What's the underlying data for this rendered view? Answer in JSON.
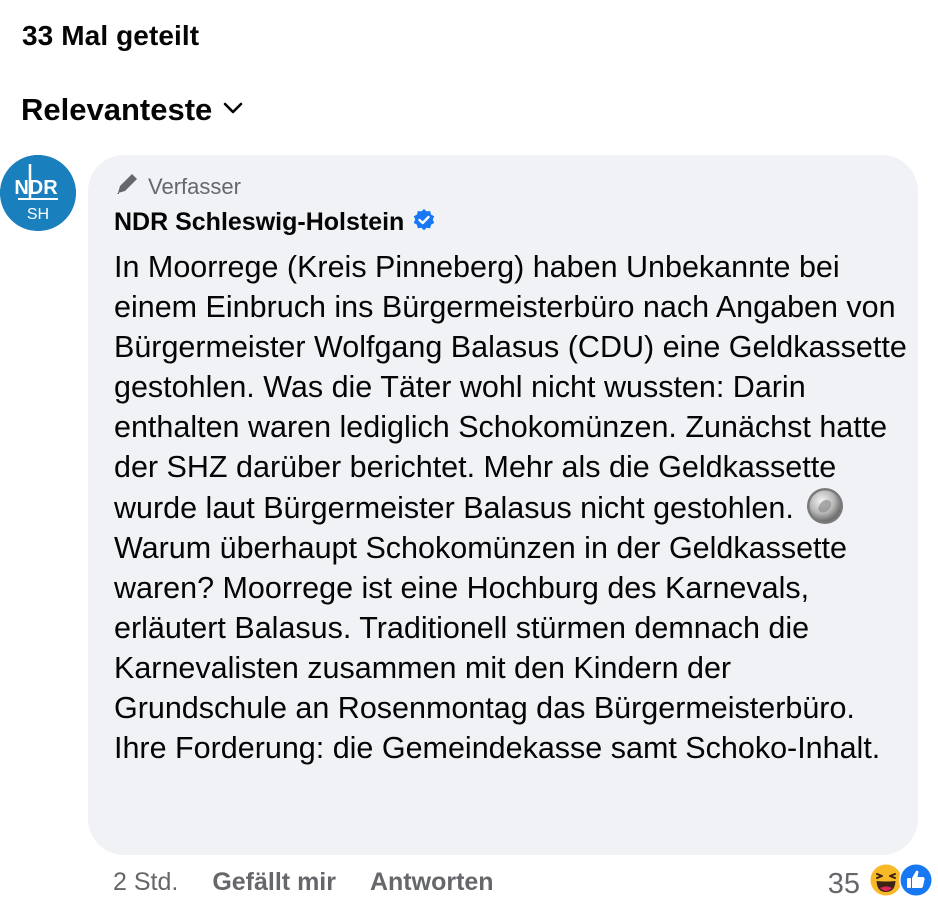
{
  "header": {
    "share_count": "33 Mal geteilt",
    "sort_label": "Relevanteste"
  },
  "comment": {
    "avatar": {
      "line1": "NDR",
      "line2": "SH",
      "bg_color": "#1a7fbd"
    },
    "badge_label": "Verfasser",
    "author": "NDR Schleswig-Holstein",
    "verified_color": "#1877f2",
    "text_part1": "In Moorrege (Kreis Pinneberg) haben Unbekannte bei einem Einbruch ins Bürgermeisterbüro nach Angaben von Bürgermeister Wolfgang Balasus (CDU) eine Geldkassette gestohlen. Was die Täter wohl nicht wussten: Darin enthalten waren lediglich Schokomünzen. Zunächst hatte der SHZ darüber berichtet. Mehr als die Geldkassette wurde laut Bürgermeister Balasus nicht gestohlen.",
    "text_part2": "Warum überhaupt Schokomünzen in der Geldkassette waren? Moorrege ist eine Hochburg des Karnevals, erläutert Balasus. Traditionell stürmen demnach die Karnevalisten zusammen mit den Kindern der Grundschule an Rosenmontag das Bürgermeisterbüro. Ihre Forderung: die Gemeindekasse samt Schoko-Inhalt.",
    "emoji_icon": "coin-emoji",
    "time": "2 Std.",
    "like_label": "Gefällt mir",
    "reply_label": "Antworten",
    "reaction_count": "35",
    "reaction_icons": [
      "laughing-face-icon",
      "like-thumb-icon"
    ]
  }
}
